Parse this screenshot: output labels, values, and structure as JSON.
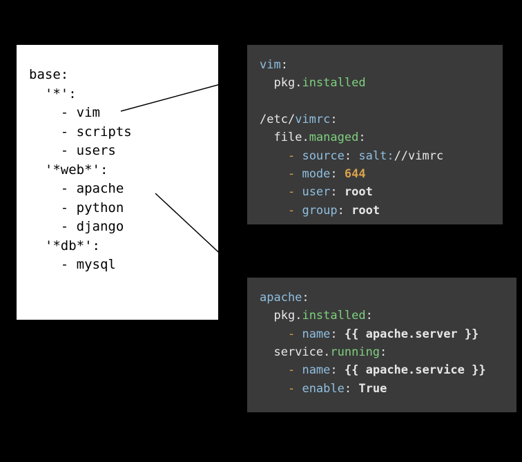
{
  "topfile": {
    "base_key": "base:",
    "star_key": "'*':",
    "star_items": [
      "vim",
      "scripts",
      "users"
    ],
    "web_key": "'*web*':",
    "web_items": [
      "apache",
      "python",
      "django"
    ],
    "db_key": "'*db*':",
    "db_items": [
      "mysql"
    ]
  },
  "vim_state": {
    "key_vim": "vim",
    "pkg": "pkg",
    "installed": "installed",
    "path": "/etc/",
    "vimrc": "vimrc",
    "file": "file",
    "managed": "managed",
    "dash": "-",
    "source_k": "source",
    "source_v_prefix": "salt:",
    "source_v_suffix": "//vimrc",
    "mode_k": "mode",
    "mode_v": "644",
    "user_k": "user",
    "user_v": "root",
    "group_k": "group",
    "group_v": "root"
  },
  "apache_state": {
    "key_apache": "apache",
    "pkg": "pkg",
    "installed": "installed",
    "service": "service",
    "running": "running",
    "dash": "-",
    "name_k": "name",
    "name_server_v": "{{ apache.server }}",
    "name_service_v": "{{ apache.service }}",
    "enable_k": "enable",
    "enable_v": "True"
  }
}
